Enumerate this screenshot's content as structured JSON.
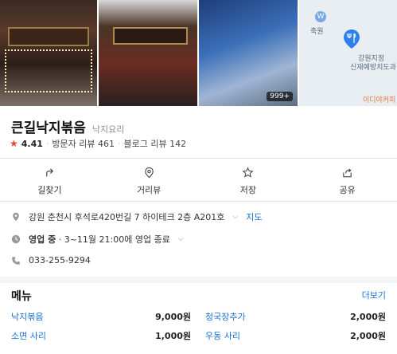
{
  "photos": {
    "count_badge": "999+"
  },
  "map": {
    "labels": [
      "축원",
      "강원지정",
      "신재예방치도과",
      "이디야커피"
    ]
  },
  "place": {
    "name": "큰길낙지볶음",
    "category": "낙지요리",
    "rating": "4.41",
    "visitor_reviews": "방문자 리뷰 461",
    "blog_reviews": "블로그 리뷰 142"
  },
  "actions": [
    {
      "label": "길찾기",
      "icon": "directions-icon"
    },
    {
      "label": "거리뷰",
      "icon": "location-pin-icon"
    },
    {
      "label": "저장",
      "icon": "star-icon"
    },
    {
      "label": "공유",
      "icon": "share-icon"
    }
  ],
  "info": {
    "address": "강원 춘천시 후석로420번길 7 하이테크 2층 A201호",
    "map_link": "지도",
    "hours_status": "영업 중",
    "hours_detail": "3~11월 21:00에 영업 종료",
    "phone": "033-255-9294"
  },
  "menu": {
    "heading": "메뉴",
    "more_label": "더보기",
    "items": [
      {
        "name": "낙지볶음",
        "price": "9,000원"
      },
      {
        "name": "청국장추가",
        "price": "2,000원"
      },
      {
        "name": "소면 사리",
        "price": "1,000원"
      },
      {
        "name": "우동 사리",
        "price": "2,000원"
      }
    ]
  },
  "colors": {
    "accent": "#1a6fd6",
    "star": "#e5472d",
    "map_pin": "#2f80ed"
  }
}
